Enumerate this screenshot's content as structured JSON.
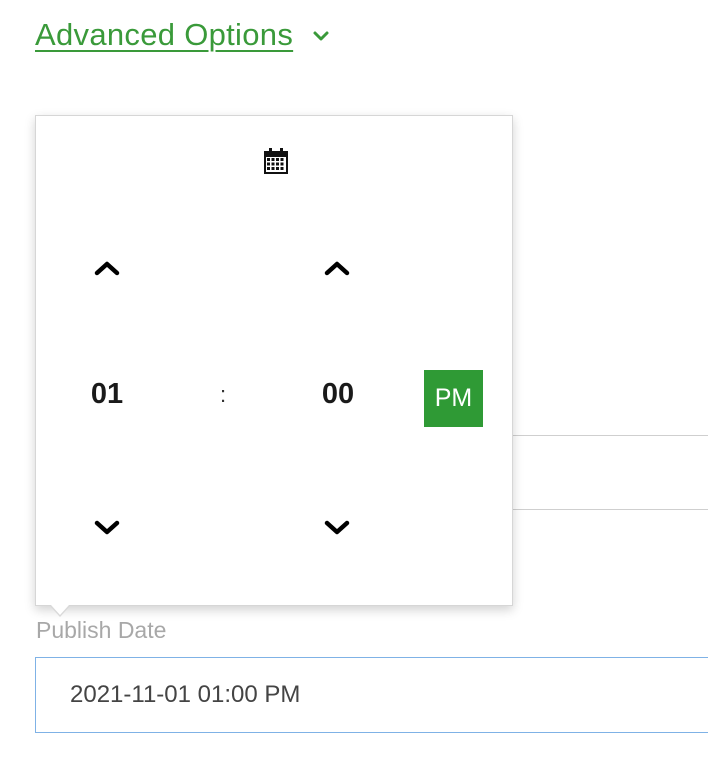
{
  "advanced_options": {
    "label": "Advanced Options",
    "chevron_icon": "chevron-down-icon",
    "accent_color": "#3a9a3a"
  },
  "time_picker": {
    "calendar_icon": "calendar-icon",
    "hour": "01",
    "separator": ":",
    "minute": "00",
    "period": "PM",
    "period_color": "#2f9a35",
    "increment_icon": "chevron-up-icon",
    "decrement_icon": "chevron-down-icon"
  },
  "publish_date": {
    "label": "Publish Date",
    "value": "2021-11-01 01:00 PM"
  }
}
